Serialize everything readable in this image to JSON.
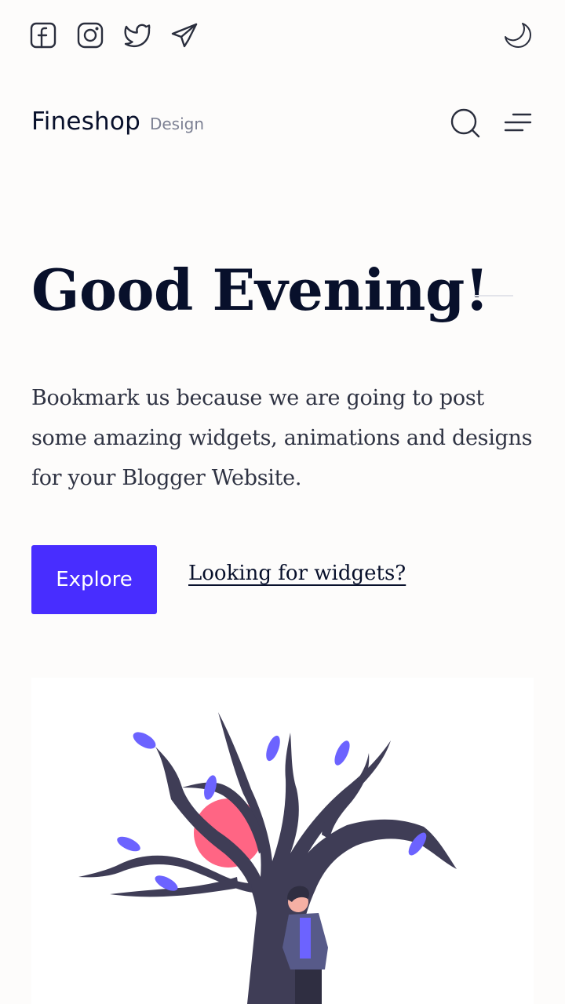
{
  "social": {
    "icons": [
      "facebook-icon",
      "instagram-icon",
      "twitter-icon",
      "telegram-icon"
    ]
  },
  "theme_toggle": {
    "icon": "moon-icon"
  },
  "header": {
    "brand_name": "Fineshop",
    "brand_sub": "Design",
    "search_icon": "search-icon",
    "menu_icon": "menu-icon"
  },
  "hero": {
    "title": "Good Evening!",
    "text": "Bookmark us because we are going to post some amazing widgets, animations and designs for your Blogger Website.",
    "explore_label": "Explore",
    "link_label": "Looking for widgets?"
  },
  "colors": {
    "accent": "#482dff",
    "text_dark": "#08102b",
    "text_muted": "#7c8093",
    "background": "#fdfcfb",
    "leaf": "#6c63ff",
    "sun": "#ff6584",
    "trunk": "#3f3d56"
  }
}
